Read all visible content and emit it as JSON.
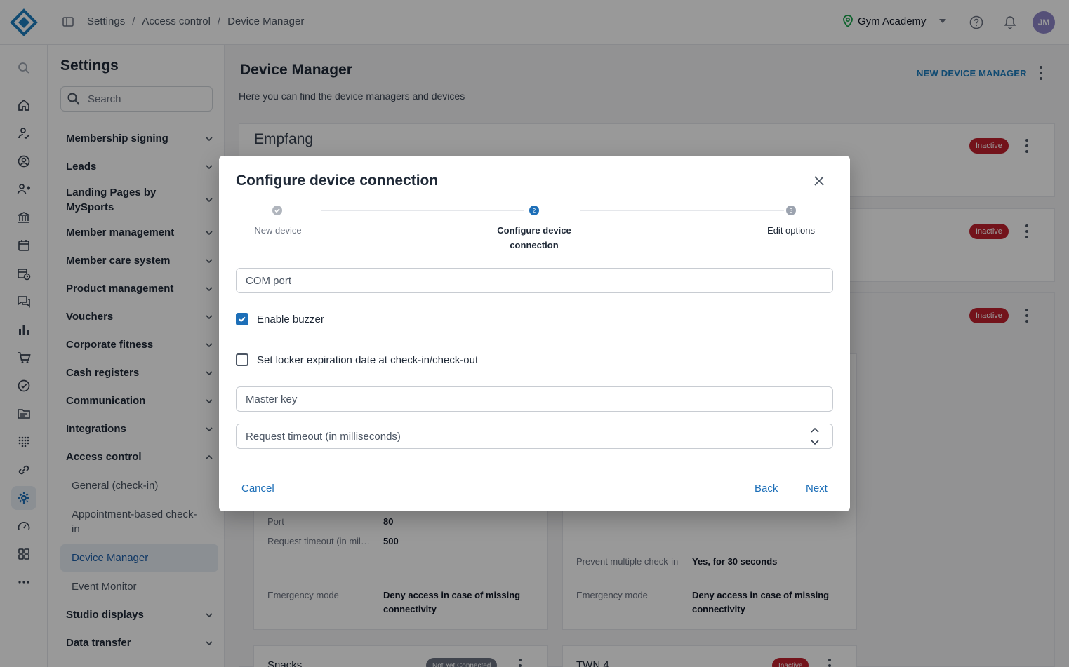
{
  "breadcrumb": [
    "Settings",
    "Access control",
    "Device Manager"
  ],
  "studio_name": "Gym Academy",
  "user_initials": "JM",
  "settings": {
    "title": "Settings",
    "search_placeholder": "Search",
    "nav": [
      "Membership signing",
      "Leads",
      "Landing Pages by MySports",
      "Member management",
      "Member care system",
      "Product management",
      "Vouchers",
      "Corporate fitness",
      "Cash registers",
      "Communication",
      "Integrations",
      "Access control"
    ],
    "access_sub": [
      "General (check-in)",
      "Appointment-based check-in",
      "Device Manager",
      "Event Monitor"
    ],
    "nav_after": [
      "Studio displays",
      "Data transfer"
    ]
  },
  "main": {
    "title": "Device Manager",
    "subtitle": "Here you can find the device managers and devices",
    "new_button": "NEW DEVICE MANAGER",
    "first_manager": "Empfang",
    "status_inactive": "Inactive",
    "status_not_connected": "Not Yet Connected",
    "left_device": {
      "port_label": "Port",
      "port_value": "80",
      "timeout_label": "Request timeout (in mil…",
      "timeout_value": "500",
      "emergency_label": "Emergency mode",
      "emergency_value": "Deny access in case of missing connectivity"
    },
    "right_device": {
      "multi_label": "Prevent multiple check-in",
      "multi_value": "Yes, for 30 seconds",
      "emergency_label": "Emergency mode",
      "emergency_value": "Deny access in case of missing connectivity"
    },
    "bottom_cards": [
      "Snacks",
      "TWN 4"
    ]
  },
  "modal": {
    "title": "Configure device connection",
    "steps": [
      {
        "number": "1",
        "label": "New device",
        "state": "done"
      },
      {
        "number": "2",
        "label": "Configure device connection",
        "state": "active"
      },
      {
        "number": "3",
        "label": "Edit options",
        "state": "pending"
      }
    ],
    "com_port_placeholder": "COM port",
    "enable_buzzer": {
      "label": "Enable buzzer",
      "checked": true
    },
    "locker_expiration": {
      "label": "Set locker expiration date at check-in/check-out",
      "checked": false
    },
    "master_key_placeholder": "Master key",
    "request_timeout_placeholder": "Request timeout (in milliseconds)",
    "cancel": "Cancel",
    "back": "Back",
    "next": "Next"
  },
  "colors": {
    "accent": "#1d6fb8",
    "inactive_badge": "#c0202e",
    "brand": "#1d7dbf"
  },
  "icons": {
    "rail": [
      "search-icon",
      "home-icon",
      "member-sign-icon",
      "account-icon",
      "add-person-icon",
      "bank-icon",
      "calendar-icon",
      "calendar-clock-icon",
      "chat-icon",
      "bar-chart-icon",
      "cart-icon",
      "check-circle-icon",
      "folder-icon",
      "grid-dots-icon",
      "link-icon",
      "gear-icon",
      "gauge-icon",
      "apps-icon",
      "more-icon"
    ]
  }
}
